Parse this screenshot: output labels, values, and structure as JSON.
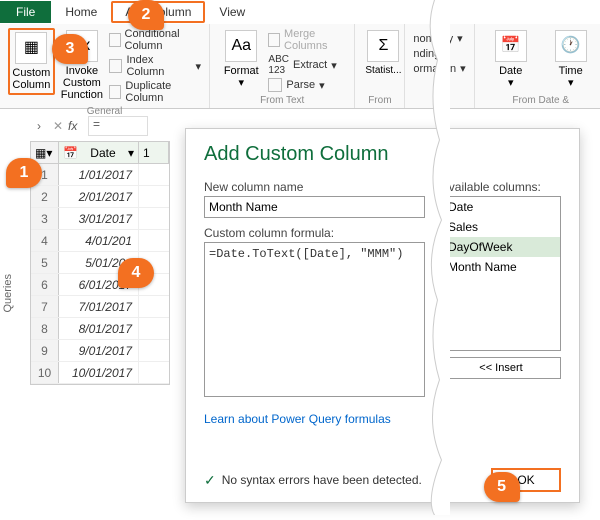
{
  "tabs": {
    "file": "File",
    "home": "Home",
    "addcol": "Add Column",
    "view": "View"
  },
  "ribbon": {
    "group_general": "General",
    "custom_column": "Custom\nColumn",
    "invoke": "Invoke Custom\nFunction",
    "conditional": "Conditional Column",
    "index": "Index Column",
    "duplicate": "Duplicate Column",
    "group_text": "From Text",
    "format": "Format",
    "merge": "Merge Columns",
    "extract": "Extract",
    "parse": "Parse",
    "statistics": "Statistics",
    "group_number_partial": "From",
    "geometry": "nometry",
    "rounding": "nding",
    "information": "ormation",
    "group_datetime": "From Date &",
    "date": "Date",
    "time": "Time"
  },
  "fx": {
    "eq": "="
  },
  "grid": {
    "header_date": "Date",
    "header_extra": "1",
    "rows": [
      {
        "n": "1",
        "d": "1/01/2017"
      },
      {
        "n": "2",
        "d": "2/01/2017"
      },
      {
        "n": "3",
        "d": "3/01/2017"
      },
      {
        "n": "4",
        "d": "4/01/201"
      },
      {
        "n": "5",
        "d": "5/01/201"
      },
      {
        "n": "6",
        "d": "6/01/2017"
      },
      {
        "n": "7",
        "d": "7/01/2017"
      },
      {
        "n": "8",
        "d": "8/01/2017"
      },
      {
        "n": "9",
        "d": "9/01/2017"
      },
      {
        "n": "10",
        "d": "10/01/2017"
      }
    ]
  },
  "queries_tab": "Queries",
  "dialog": {
    "title": "Add Custom Column",
    "new_col_label": "New column name",
    "new_col_value": "Month Name",
    "formula_label": "Custom column formula:",
    "formula_value": "=Date.ToText([Date], \"MMM\")",
    "avail_label": "Available columns:",
    "avail": [
      "Date",
      "Sales",
      "DayOfWeek",
      "Month Name"
    ],
    "insert": "<< Insert",
    "learn": "Learn about Power Query formulas",
    "status": "No syntax errors have been detected.",
    "ok": "OK"
  },
  "callouts": {
    "1": "1",
    "2": "2",
    "3": "3",
    "4": "4",
    "5": "5"
  }
}
